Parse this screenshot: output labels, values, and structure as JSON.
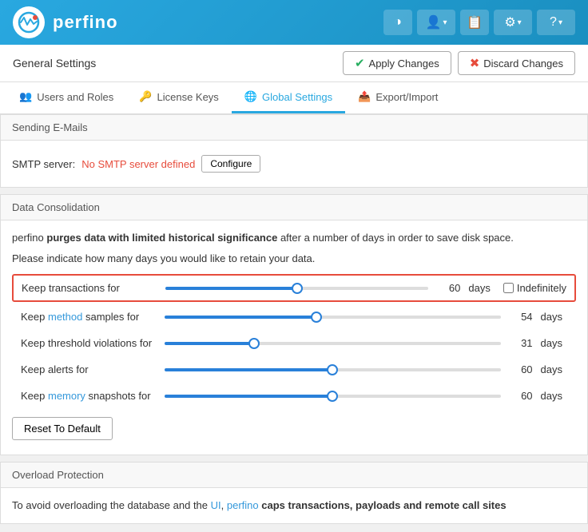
{
  "header": {
    "logo_text": "perfino",
    "icon_theme": "⬤",
    "icon_user": "👤",
    "icon_clipboard": "📋",
    "icon_gear": "⚙",
    "icon_help": "?"
  },
  "topbar": {
    "title": "General Settings",
    "apply_label": "Apply Changes",
    "discard_label": "Discard Changes"
  },
  "tabs": [
    {
      "id": "users",
      "label": "Users and Roles",
      "icon": "👥",
      "active": false
    },
    {
      "id": "license",
      "label": "License Keys",
      "icon": "🔑",
      "active": false
    },
    {
      "id": "global",
      "label": "Global Settings",
      "icon": "🌐",
      "active": true
    },
    {
      "id": "export",
      "label": "Export/Import",
      "icon": "📤",
      "active": false
    }
  ],
  "sending_emails": {
    "section_title": "Sending E-Mails",
    "smtp_label": "SMTP server:",
    "smtp_status": "No SMTP server defined",
    "configure_label": "Configure"
  },
  "data_consolidation": {
    "section_title": "Data Consolidation",
    "desc1_before": "perfino ",
    "desc1_bold": "purges data with limited historical significance",
    "desc1_after": " after a number of days in order to save disk space.",
    "desc2": "Please indicate how many days you would like to retain your data.",
    "sliders": [
      {
        "label": "Keep transactions for",
        "value": 60,
        "max": 120,
        "unit": "days",
        "pct": 50,
        "highlighted": true,
        "has_indefinitely": true
      },
      {
        "label": "Keep method samples for",
        "label_link": "method",
        "value": 54,
        "max": 120,
        "unit": "days",
        "pct": 45,
        "highlighted": false
      },
      {
        "label": "Keep threshold violations for",
        "value": 31,
        "max": 120,
        "unit": "days",
        "pct": 26,
        "highlighted": false
      },
      {
        "label": "Keep alerts for",
        "value": 60,
        "max": 120,
        "unit": "days",
        "pct": 50,
        "highlighted": false
      },
      {
        "label": "Keep memory snapshots for",
        "label_link": "memory",
        "value": 60,
        "max": 120,
        "unit": "days",
        "pct": 50,
        "highlighted": false
      }
    ],
    "reset_label": "Reset To Default",
    "indefinitely_label": "Indefinitely"
  },
  "overload_protection": {
    "section_title": "Overload Protection",
    "desc": "To avoid overloading the database and the UI, perfino caps transactions, payloads and remote call sites"
  }
}
